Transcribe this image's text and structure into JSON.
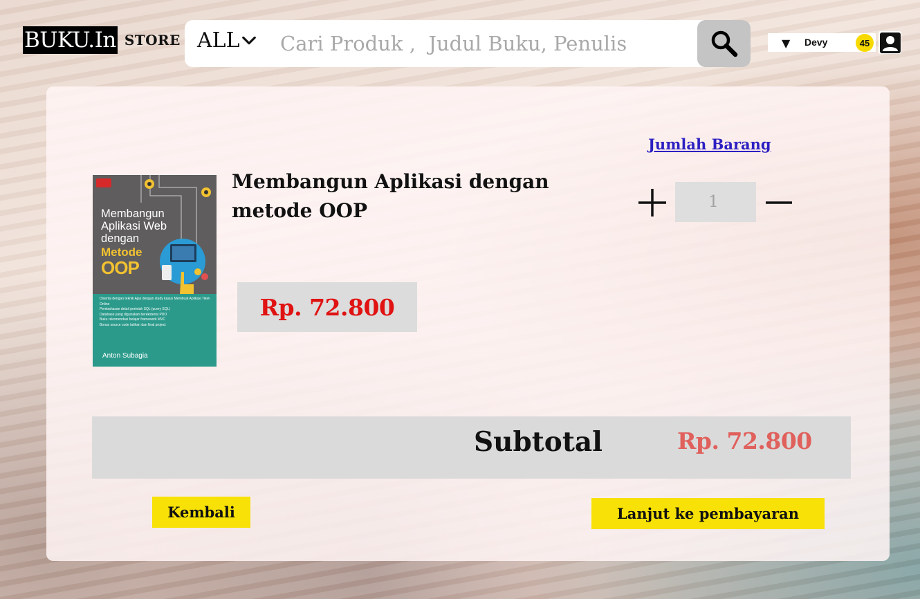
{
  "header": {
    "logo_text": "BUKU.In",
    "logo_store": "STORE",
    "category": "ALL",
    "search_placeholder": "Cari Produk ,  Judul Buku, Penulis",
    "user_name": "Devy",
    "notification_count": "45"
  },
  "cart": {
    "qty_header": "Jumlah Barang",
    "item": {
      "title": "Membangun Aplikasi dengan\n metode OOP",
      "price": "Rp. 72.800",
      "quantity": "1",
      "cover": {
        "title_line": "Membangun Aplikasi Web dengan",
        "title_highlight_1": "Metode",
        "title_highlight_2": "OOP",
        "bullets": [
          "Disertai dengan teknik Ajax dengan study kasus Membuat Aplikasi Tiket-Online",
          "Pembahasan detail perintah SQL (query SQL)",
          "Database yang digunakan berekstensi PDO",
          "Buku rekomendasi belajar framework MVC",
          "Bonus source code latihan dan final project"
        ],
        "author": "Anton Subagia"
      }
    },
    "subtotal_label": "Subtotal",
    "subtotal_value": "Rp. 72.800"
  },
  "actions": {
    "back_label": "Kembali",
    "continue_label": "Lanjut ke pembayaran"
  },
  "colors": {
    "accent_yellow": "#f7e106",
    "price_red": "#e01212",
    "subtotal_red": "#e0605c",
    "link_blue": "#2c1fc2"
  }
}
